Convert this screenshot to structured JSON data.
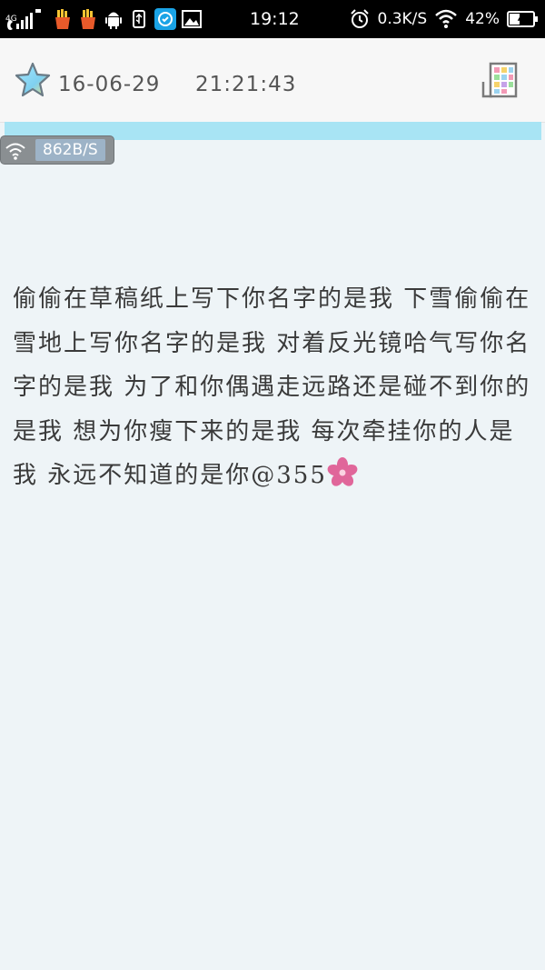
{
  "status_bar": {
    "network_type": "4G",
    "time": "19:12",
    "speed": "0.3K/S",
    "battery": "42%"
  },
  "header": {
    "date": "16-06-29",
    "time": "21:21:43"
  },
  "speed_badge": {
    "value": "862B/S"
  },
  "note": {
    "text": "偷偷在草稿纸上写下你名字的是我 下雪偷偷在雪地上写你名字的是我 对着反光镜哈气写你名字的是我 为了和你偶遇走远路还是碰不到你的是我 想为你瘦下来的是我 每次牵挂你的人是我 永远不知道的是你@355"
  },
  "colors": {
    "strip": "#a8e4f4",
    "background": "#eef4f7",
    "flower": "#e0669a"
  }
}
